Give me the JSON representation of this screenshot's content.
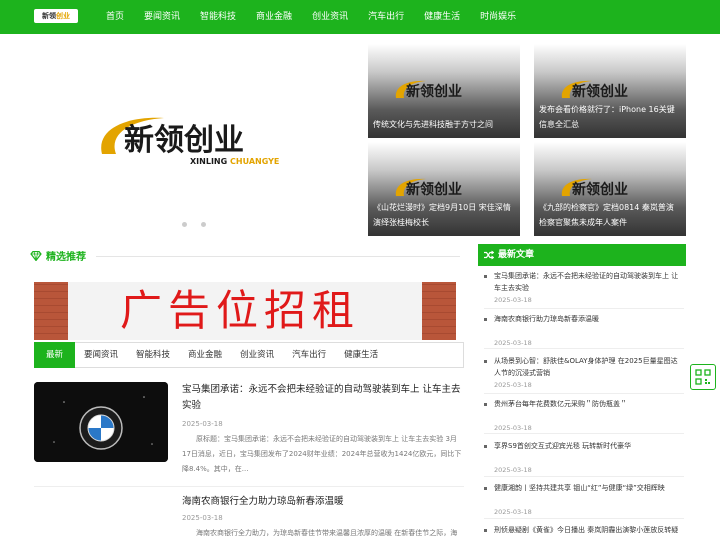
{
  "brand": {
    "logo_text_a": "新领",
    "logo_text_b": "创业",
    "brand_cn": "新领创业",
    "brand_en_a": "XINLING",
    "brand_en_b": "CHUANGYE",
    "brand_color": "#1db31d",
    "accent_color": "#e3a400"
  },
  "nav": {
    "items": [
      "首页",
      "要闻资讯",
      "智能科技",
      "商业金融",
      "创业资讯",
      "汽车出行",
      "健康生活",
      "时尚娱乐"
    ]
  },
  "hero": {
    "tiles": [
      {
        "caption": "传统文化与先进科技融于方寸之间"
      },
      {
        "caption": "发布会看价格就行了：iPhone 16关键信息全汇总"
      },
      {
        "caption": "《山花烂漫时》定档9月10日 宋佳深情演绎张桂梅校长"
      },
      {
        "caption": "《九部的检察官》定档0814 秦岚普演检察官聚焦未成年人案件"
      }
    ]
  },
  "featured": {
    "title": "精选推荐",
    "ad_text": "广告位招租",
    "tabs": [
      "最新",
      "要闻资讯",
      "智能科技",
      "商业金融",
      "创业资讯",
      "汽车出行",
      "健康生活"
    ],
    "active_tab": "最新"
  },
  "articles": [
    {
      "title": "宝马集团承诺：永远不会把未经验证的自动驾驶装到车上 让车主去实验",
      "date": "2025-03-18",
      "desc": "原标题：宝马集团承诺：永远不会把未经验证的自动驾驶装到车上 让车主去实验 3月17日消息，近日，宝马集团发布了2024财年业绩：2024年总营收为1424亿欧元，同比下降8.4%。其中，在..."
    },
    {
      "title": "海南农商银行全力助力琼岛新春添温暖",
      "date": "2025-03-18",
      "desc": "海南农商银行全力助力，为琼岛新春佳节带来温馨且浓厚的温暖 在新春佳节之际，海"
    }
  ],
  "sidebar": {
    "title": "最新文章",
    "items": [
      {
        "title": "宝马集团承诺：永远不会把未经验证的自动驾驶装到车上 让车主去实验",
        "date": "2025-03-18"
      },
      {
        "title": "海南农商银行助力琼岛新春添温暖",
        "date": "2025-03-18"
      },
      {
        "title": "从场景到心智：舒肤佳&OLAY身体护理 在2025巨量星图达人节的沉浸式营销",
        "date": "2025-03-18"
      },
      {
        "title": "贵州茅台每年花费数亿元采购＂防伪瓶盖＂",
        "date": "2025-03-18"
      },
      {
        "title": "享界S9首创交互式迎宾光毯 玩转新时代豪华",
        "date": "2025-03-18"
      },
      {
        "title": "健康湘韵丨坚持共建共享 铟山“红”与健康“绿”交相辉映",
        "date": "2025-03-18"
      },
      {
        "title": "刑侦悬疑剧《黄雀》今日播出 秦岚阴霾出演黎小莲放反转疑",
        "date": ""
      }
    ]
  }
}
